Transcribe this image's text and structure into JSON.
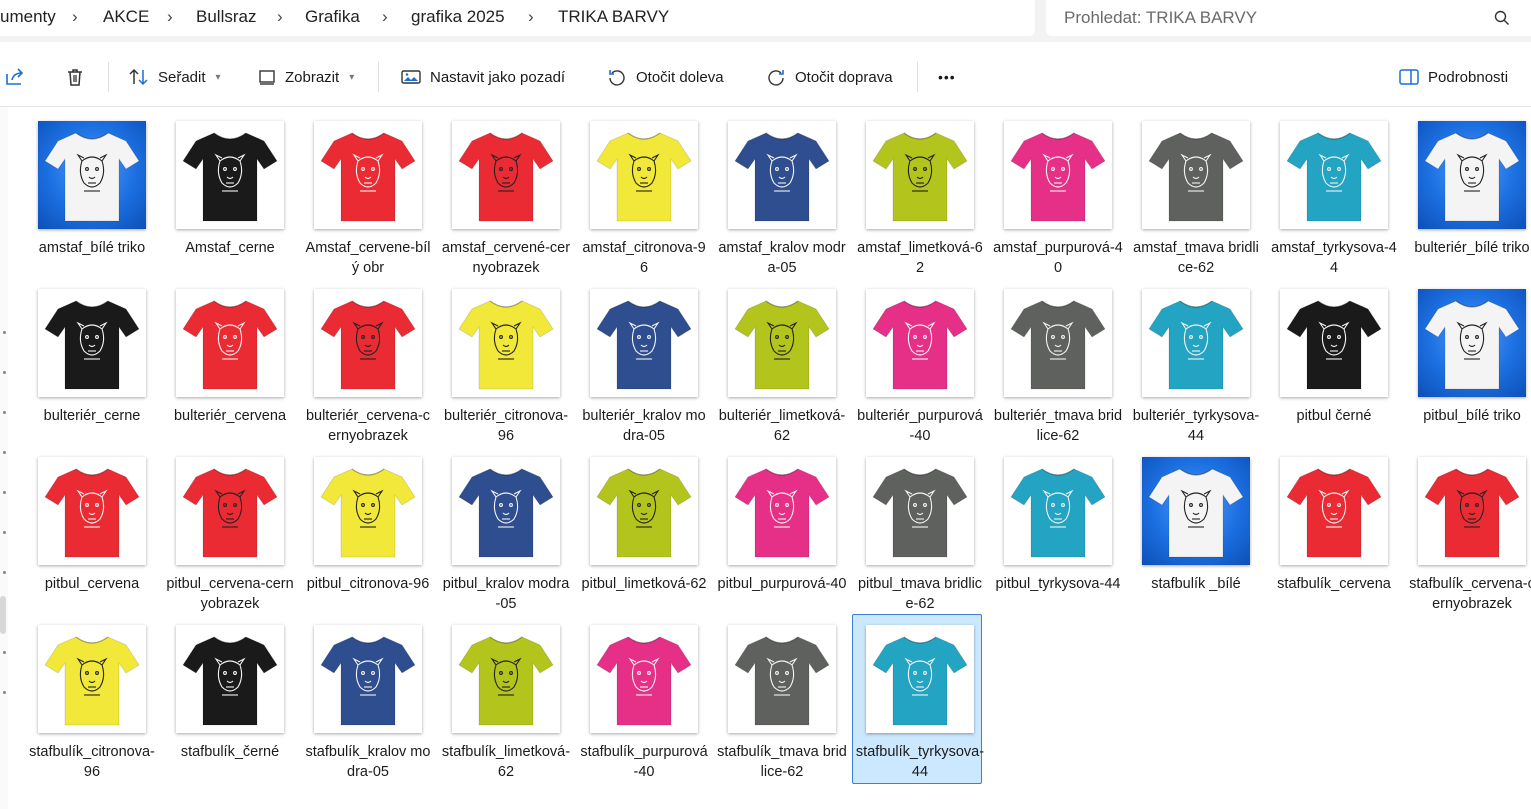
{
  "breadcrumb": [
    "umenty",
    "AKCE",
    "Bullsraz",
    "Grafika",
    "grafika 2025",
    "TRIKA BARVY"
  ],
  "search": {
    "placeholder": "Prohledat: TRIKA BARVY"
  },
  "toolbar": {
    "sort": "Seřadit",
    "view": "Zobrazit",
    "set_background": "Nastavit jako pozadí",
    "rotate_left": "Otočit doleva",
    "rotate_right": "Otočit doprava",
    "more": "•••",
    "details": "Podrobnosti"
  },
  "colors": {
    "white": "#f4f4f4",
    "black": "#1a1a1a",
    "red": "#ea2b33",
    "yellow": "#f2e83a",
    "royal": "#2f4e8f",
    "lime": "#b3c41c",
    "pink": "#e62f86",
    "slate": "#5f615e",
    "teal": "#22a4c2",
    "selection": "#cce8ff"
  },
  "files": [
    {
      "name": "amstaf_bílé triko",
      "color": "white",
      "bg": "blue"
    },
    {
      "name": "Amstaf_cerne",
      "color": "black"
    },
    {
      "name": "Amstaf_cervene-bílý obr",
      "color": "red"
    },
    {
      "name": "amstaf_cervené-cernyobrazek",
      "color": "red"
    },
    {
      "name": "amstaf_citronova-96",
      "color": "yellow"
    },
    {
      "name": "amstaf_kralov modra-05",
      "color": "royal"
    },
    {
      "name": "amstaf_limetková-62",
      "color": "lime"
    },
    {
      "name": "amstaf_purpurová-40",
      "color": "pink"
    },
    {
      "name": "amstaf_tmava bridlice-62",
      "color": "slate"
    },
    {
      "name": "amstaf_tyrkysova-44",
      "color": "teal"
    },
    {
      "name": "bulteriér_bílé triko",
      "color": "white",
      "bg": "blue"
    },
    {
      "name": "bulteriér_cerne",
      "color": "black"
    },
    {
      "name": "bulteriér_cervena",
      "color": "red"
    },
    {
      "name": "bulteriér_cervena-cernyobrazek",
      "color": "red"
    },
    {
      "name": "bulteriér_citronova-96",
      "color": "yellow"
    },
    {
      "name": "bulteriér_kralov modra-05",
      "color": "royal"
    },
    {
      "name": "bulteriér_limetková-62",
      "color": "lime"
    },
    {
      "name": "bulteriér_purpurová-40",
      "color": "pink"
    },
    {
      "name": "bulteriér_tmava bridlice-62",
      "color": "slate"
    },
    {
      "name": "bulteriér_tyrkysova-44",
      "color": "teal"
    },
    {
      "name": "pitbul černé",
      "color": "black"
    },
    {
      "name": "pitbul_bílé triko",
      "color": "white",
      "bg": "blue"
    },
    {
      "name": "pitbul_cervena",
      "color": "red"
    },
    {
      "name": "pitbul_cervena-cernyobrazek",
      "color": "red"
    },
    {
      "name": "pitbul_citronova-96",
      "color": "yellow"
    },
    {
      "name": "pitbul_kralov modra-05",
      "color": "royal"
    },
    {
      "name": "pitbul_limetková-62",
      "color": "lime"
    },
    {
      "name": "pitbul_purpurová-40",
      "color": "pink"
    },
    {
      "name": "pitbul_tmava bridlice-62",
      "color": "slate"
    },
    {
      "name": "pitbul_tyrkysova-44",
      "color": "teal"
    },
    {
      "name": "stafbulík _bílé",
      "color": "white",
      "bg": "blue"
    },
    {
      "name": "stafbulík_cervena",
      "color": "red"
    },
    {
      "name": "stafbulík_cervena-cernyobrazek",
      "color": "red"
    },
    {
      "name": "stafbulík_citronova-96",
      "color": "yellow"
    },
    {
      "name": "stafbulík_černé",
      "color": "black"
    },
    {
      "name": "stafbulík_kralov modra-05",
      "color": "royal"
    },
    {
      "name": "stafbulík_limetková-62",
      "color": "lime"
    },
    {
      "name": "stafbulík_purpurová-40",
      "color": "pink"
    },
    {
      "name": "stafbulík_tmava bridlice-62",
      "color": "slate"
    },
    {
      "name": "stafbulík_tyrkysova-44",
      "color": "teal",
      "selected": true
    }
  ]
}
